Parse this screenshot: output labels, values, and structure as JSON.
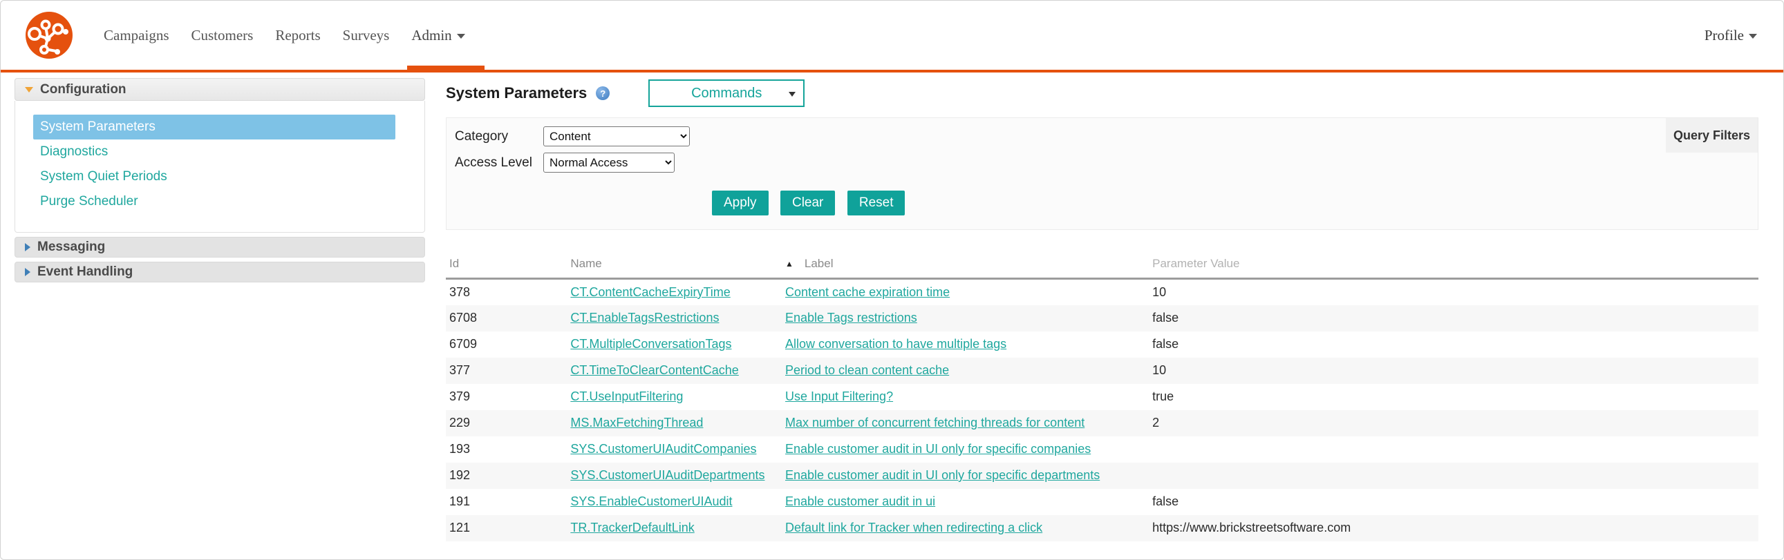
{
  "colors": {
    "accent_orange": "#e5510e",
    "teal": "#10a29a",
    "selected_blue": "#7ec2e6"
  },
  "nav": {
    "items": [
      "Campaigns",
      "Customers",
      "Reports",
      "Surveys"
    ],
    "admin_label": "Admin",
    "profile_label": "Profile"
  },
  "sidebar": {
    "sections": [
      {
        "label": "Configuration",
        "state": "expanded",
        "items": [
          {
            "label": "System Parameters",
            "selected": true
          },
          {
            "label": "Diagnostics",
            "selected": false
          },
          {
            "label": "System Quiet Periods",
            "selected": false
          },
          {
            "label": "Purge Scheduler",
            "selected": false
          }
        ]
      },
      {
        "label": "Messaging",
        "state": "collapsed"
      },
      {
        "label": "Event Handling",
        "state": "collapsed"
      }
    ]
  },
  "main": {
    "title": "System Parameters",
    "help_icon": "?",
    "commands_label": "Commands",
    "filters": {
      "query_filters_label": "Query Filters",
      "category_label": "Category",
      "category_value": "Content",
      "access_label": "Access Level",
      "access_value": "Normal Access",
      "apply_label": "Apply",
      "clear_label": "Clear",
      "reset_label": "Reset"
    },
    "table": {
      "columns": {
        "id": "Id",
        "name": "Name",
        "label": "Label",
        "value": "Parameter Value"
      },
      "sorted_column": "Label",
      "sort_direction": "ascending",
      "rows": [
        {
          "id": "378",
          "name": "CT.ContentCacheExpiryTime",
          "label": "Content cache expiration time",
          "value": "10"
        },
        {
          "id": "6708",
          "name": "CT.EnableTagsRestrictions",
          "label": "Enable Tags restrictions",
          "value": "false"
        },
        {
          "id": "6709",
          "name": "CT.MultipleConversationTags",
          "label": "Allow conversation to have multiple tags",
          "value": "false"
        },
        {
          "id": "377",
          "name": "CT.TimeToClearContentCache",
          "label": "Period to clean content cache",
          "value": "10"
        },
        {
          "id": "379",
          "name": "CT.UseInputFiltering",
          "label": "Use Input Filtering?",
          "value": "true"
        },
        {
          "id": "229",
          "name": "MS.MaxFetchingThread",
          "label": "Max number of concurrent fetching threads for content",
          "value": "2"
        },
        {
          "id": "193",
          "name": "SYS.CustomerUIAuditCompanies",
          "label": "Enable customer audit in UI only for specific companies",
          "value": ""
        },
        {
          "id": "192",
          "name": "SYS.CustomerUIAuditDepartments",
          "label": "Enable customer audit in UI only for specific departments",
          "value": ""
        },
        {
          "id": "191",
          "name": "SYS.EnableCustomerUIAudit",
          "label": "Enable customer audit in ui",
          "value": "false"
        },
        {
          "id": "121",
          "name": "TR.TrackerDefaultLink",
          "label": "Default link for Tracker when redirecting a click",
          "value": "https://www.brickstreetsoftware.com"
        }
      ]
    }
  }
}
